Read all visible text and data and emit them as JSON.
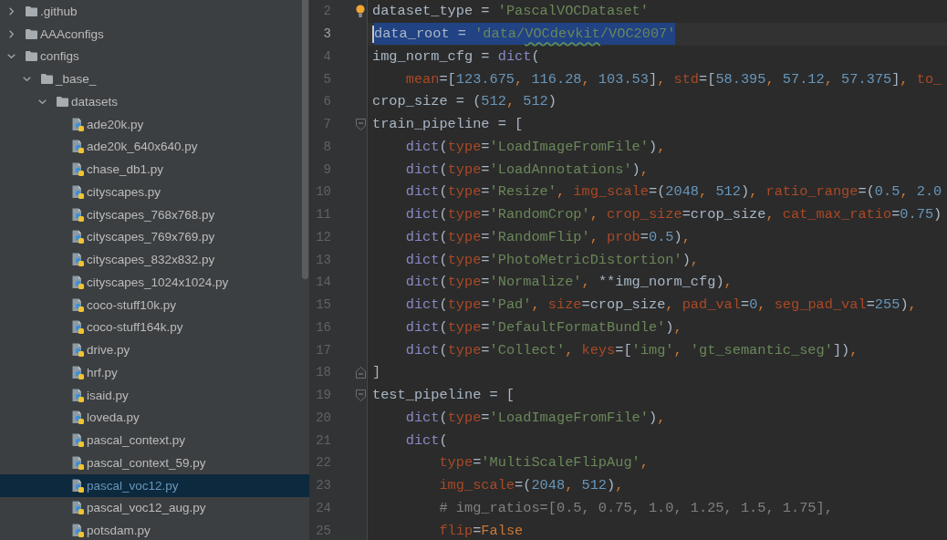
{
  "tree": [
    {
      "label": ".github",
      "kind": "folder",
      "expanded": false,
      "selected": false
    },
    {
      "label": "AAAconfigs",
      "kind": "folder",
      "expanded": false,
      "selected": false
    },
    {
      "label": "configs",
      "kind": "folder",
      "expanded": true,
      "selected": false,
      "children": [
        {
          "label": "_base_",
          "kind": "folder",
          "expanded": true,
          "selected": false,
          "children": [
            {
              "label": "datasets",
              "kind": "folder",
              "expanded": true,
              "selected": false,
              "children": [
                {
                  "label": "ade20k.py",
                  "kind": "file",
                  "selected": false,
                  "modified": false
                },
                {
                  "label": "ade20k_640x640.py",
                  "kind": "file",
                  "selected": false,
                  "modified": false
                },
                {
                  "label": "chase_db1.py",
                  "kind": "file",
                  "selected": false,
                  "modified": false
                },
                {
                  "label": "cityscapes.py",
                  "kind": "file",
                  "selected": false,
                  "modified": false
                },
                {
                  "label": "cityscapes_768x768.py",
                  "kind": "file",
                  "selected": false,
                  "modified": false
                },
                {
                  "label": "cityscapes_769x769.py",
                  "kind": "file",
                  "selected": false,
                  "modified": false
                },
                {
                  "label": "cityscapes_832x832.py",
                  "kind": "file",
                  "selected": false,
                  "modified": false
                },
                {
                  "label": "cityscapes_1024x1024.py",
                  "kind": "file",
                  "selected": false,
                  "modified": false
                },
                {
                  "label": "coco-stuff10k.py",
                  "kind": "file",
                  "selected": false,
                  "modified": false
                },
                {
                  "label": "coco-stuff164k.py",
                  "kind": "file",
                  "selected": false,
                  "modified": false
                },
                {
                  "label": "drive.py",
                  "kind": "file",
                  "selected": false,
                  "modified": false
                },
                {
                  "label": "hrf.py",
                  "kind": "file",
                  "selected": false,
                  "modified": false
                },
                {
                  "label": "isaid.py",
                  "kind": "file",
                  "selected": false,
                  "modified": false
                },
                {
                  "label": "loveda.py",
                  "kind": "file",
                  "selected": false,
                  "modified": false
                },
                {
                  "label": "pascal_context.py",
                  "kind": "file",
                  "selected": false,
                  "modified": false
                },
                {
                  "label": "pascal_context_59.py",
                  "kind": "file",
                  "selected": false,
                  "modified": false
                },
                {
                  "label": "pascal_voc12.py",
                  "kind": "file",
                  "selected": true,
                  "modified": true
                },
                {
                  "label": "pascal_voc12_aug.py",
                  "kind": "file",
                  "selected": false,
                  "modified": false
                },
                {
                  "label": "potsdam.py",
                  "kind": "file",
                  "selected": false,
                  "modified": false
                }
              ]
            }
          ]
        }
      ]
    }
  ],
  "editor": {
    "lines": [
      {
        "number": "2",
        "kind": "bulb",
        "current": false,
        "selected": false,
        "tokens": [
          {
            "kind": "plain",
            "text": "dataset_type = "
          },
          {
            "kind": "string",
            "text": "'PascalVOCDataset'"
          }
        ]
      },
      {
        "number": "3",
        "kind": "plain",
        "current": true,
        "selected": true,
        "tokens": [
          {
            "kind": "plain",
            "text": "data_root = "
          },
          {
            "kind": "string",
            "text": "'data/"
          },
          {
            "kind": "string-typo",
            "text": "VOCdevkit"
          },
          {
            "kind": "string",
            "text": "/VOC2007'"
          }
        ]
      },
      {
        "number": "4",
        "kind": "plain",
        "current": false,
        "selected": false,
        "tokens": [
          {
            "kind": "plain",
            "text": "img_norm_cfg = "
          },
          {
            "kind": "builtin",
            "text": "dict"
          },
          {
            "kind": "plain",
            "text": "("
          }
        ]
      },
      {
        "number": "5",
        "kind": "plain",
        "current": false,
        "selected": false,
        "tokens": [
          {
            "kind": "kwarg",
            "text": "    mean"
          },
          {
            "kind": "plain",
            "text": "=["
          },
          {
            "kind": "number",
            "text": "123.675"
          },
          {
            "kind": "comma",
            "text": ", "
          },
          {
            "kind": "number",
            "text": "116.28"
          },
          {
            "kind": "comma",
            "text": ", "
          },
          {
            "kind": "number",
            "text": "103.53"
          },
          {
            "kind": "plain",
            "text": "]"
          },
          {
            "kind": "comma",
            "text": ", "
          },
          {
            "kind": "kwarg",
            "text": "std"
          },
          {
            "kind": "plain",
            "text": "=["
          },
          {
            "kind": "number",
            "text": "58.395"
          },
          {
            "kind": "comma",
            "text": ", "
          },
          {
            "kind": "number",
            "text": "57.12"
          },
          {
            "kind": "comma",
            "text": ", "
          },
          {
            "kind": "number",
            "text": "57.375"
          },
          {
            "kind": "plain",
            "text": "]"
          },
          {
            "kind": "comma",
            "text": ", "
          },
          {
            "kind": "kwarg",
            "text": "to_"
          }
        ]
      },
      {
        "number": "6",
        "kind": "plain",
        "current": false,
        "selected": false,
        "tokens": [
          {
            "kind": "plain",
            "text": "crop_size = ("
          },
          {
            "kind": "number",
            "text": "512"
          },
          {
            "kind": "comma",
            "text": ", "
          },
          {
            "kind": "number",
            "text": "512"
          },
          {
            "kind": "plain",
            "text": ")"
          }
        ]
      },
      {
        "number": "7",
        "kind": "fold-start",
        "current": false,
        "selected": false,
        "tokens": [
          {
            "kind": "plain",
            "text": "train_pipeline = ["
          }
        ]
      },
      {
        "number": "8",
        "kind": "plain",
        "current": false,
        "selected": false,
        "tokens": [
          {
            "kind": "builtin",
            "text": "    dict"
          },
          {
            "kind": "plain",
            "text": "("
          },
          {
            "kind": "kwarg",
            "text": "type"
          },
          {
            "kind": "plain",
            "text": "="
          },
          {
            "kind": "string",
            "text": "'LoadImageFromFile'"
          },
          {
            "kind": "plain",
            "text": ")"
          },
          {
            "kind": "comma",
            "text": ","
          }
        ]
      },
      {
        "number": "9",
        "kind": "plain",
        "current": false,
        "selected": false,
        "tokens": [
          {
            "kind": "builtin",
            "text": "    dict"
          },
          {
            "kind": "plain",
            "text": "("
          },
          {
            "kind": "kwarg",
            "text": "type"
          },
          {
            "kind": "plain",
            "text": "="
          },
          {
            "kind": "string",
            "text": "'LoadAnnotations'"
          },
          {
            "kind": "plain",
            "text": ")"
          },
          {
            "kind": "comma",
            "text": ","
          }
        ]
      },
      {
        "number": "10",
        "kind": "plain",
        "current": false,
        "selected": false,
        "tokens": [
          {
            "kind": "builtin",
            "text": "    dict"
          },
          {
            "kind": "plain",
            "text": "("
          },
          {
            "kind": "kwarg",
            "text": "type"
          },
          {
            "kind": "plain",
            "text": "="
          },
          {
            "kind": "string",
            "text": "'Resize'"
          },
          {
            "kind": "comma",
            "text": ", "
          },
          {
            "kind": "kwarg",
            "text": "img_scale"
          },
          {
            "kind": "plain",
            "text": "=("
          },
          {
            "kind": "number",
            "text": "2048"
          },
          {
            "kind": "comma",
            "text": ", "
          },
          {
            "kind": "number",
            "text": "512"
          },
          {
            "kind": "plain",
            "text": ")"
          },
          {
            "kind": "comma",
            "text": ", "
          },
          {
            "kind": "kwarg",
            "text": "ratio_range"
          },
          {
            "kind": "plain",
            "text": "=("
          },
          {
            "kind": "number",
            "text": "0.5"
          },
          {
            "kind": "comma",
            "text": ", "
          },
          {
            "kind": "number",
            "text": "2.0"
          }
        ]
      },
      {
        "number": "11",
        "kind": "plain",
        "current": false,
        "selected": false,
        "tokens": [
          {
            "kind": "builtin",
            "text": "    dict"
          },
          {
            "kind": "plain",
            "text": "("
          },
          {
            "kind": "kwarg",
            "text": "type"
          },
          {
            "kind": "plain",
            "text": "="
          },
          {
            "kind": "string",
            "text": "'RandomCrop'"
          },
          {
            "kind": "comma",
            "text": ", "
          },
          {
            "kind": "kwarg",
            "text": "crop_size"
          },
          {
            "kind": "plain",
            "text": "=crop_size"
          },
          {
            "kind": "comma",
            "text": ", "
          },
          {
            "kind": "kwarg",
            "text": "cat_max_ratio"
          },
          {
            "kind": "plain",
            "text": "="
          },
          {
            "kind": "number",
            "text": "0.75"
          },
          {
            "kind": "plain",
            "text": ")"
          }
        ]
      },
      {
        "number": "12",
        "kind": "plain",
        "current": false,
        "selected": false,
        "tokens": [
          {
            "kind": "builtin",
            "text": "    dict"
          },
          {
            "kind": "plain",
            "text": "("
          },
          {
            "kind": "kwarg",
            "text": "type"
          },
          {
            "kind": "plain",
            "text": "="
          },
          {
            "kind": "string",
            "text": "'RandomFlip'"
          },
          {
            "kind": "comma",
            "text": ", "
          },
          {
            "kind": "kwarg",
            "text": "prob"
          },
          {
            "kind": "plain",
            "text": "="
          },
          {
            "kind": "number",
            "text": "0.5"
          },
          {
            "kind": "plain",
            "text": ")"
          },
          {
            "kind": "comma",
            "text": ","
          }
        ]
      },
      {
        "number": "13",
        "kind": "plain",
        "current": false,
        "selected": false,
        "tokens": [
          {
            "kind": "builtin",
            "text": "    dict"
          },
          {
            "kind": "plain",
            "text": "("
          },
          {
            "kind": "kwarg",
            "text": "type"
          },
          {
            "kind": "plain",
            "text": "="
          },
          {
            "kind": "string",
            "text": "'PhotoMetricDistortion'"
          },
          {
            "kind": "plain",
            "text": ")"
          },
          {
            "kind": "comma",
            "text": ","
          }
        ]
      },
      {
        "number": "14",
        "kind": "plain",
        "current": false,
        "selected": false,
        "tokens": [
          {
            "kind": "builtin",
            "text": "    dict"
          },
          {
            "kind": "plain",
            "text": "("
          },
          {
            "kind": "kwarg",
            "text": "type"
          },
          {
            "kind": "plain",
            "text": "="
          },
          {
            "kind": "string",
            "text": "'Normalize'"
          },
          {
            "kind": "comma",
            "text": ", "
          },
          {
            "kind": "plain",
            "text": "**img_norm_cfg)"
          },
          {
            "kind": "comma",
            "text": ","
          }
        ]
      },
      {
        "number": "15",
        "kind": "plain",
        "current": false,
        "selected": false,
        "tokens": [
          {
            "kind": "builtin",
            "text": "    dict"
          },
          {
            "kind": "plain",
            "text": "("
          },
          {
            "kind": "kwarg",
            "text": "type"
          },
          {
            "kind": "plain",
            "text": "="
          },
          {
            "kind": "string",
            "text": "'Pad'"
          },
          {
            "kind": "comma",
            "text": ", "
          },
          {
            "kind": "kwarg",
            "text": "size"
          },
          {
            "kind": "plain",
            "text": "=crop_size"
          },
          {
            "kind": "comma",
            "text": ", "
          },
          {
            "kind": "kwarg",
            "text": "pad_val"
          },
          {
            "kind": "plain",
            "text": "="
          },
          {
            "kind": "number",
            "text": "0"
          },
          {
            "kind": "comma",
            "text": ", "
          },
          {
            "kind": "kwarg",
            "text": "seg_pad_val"
          },
          {
            "kind": "plain",
            "text": "="
          },
          {
            "kind": "number",
            "text": "255"
          },
          {
            "kind": "plain",
            "text": ")"
          },
          {
            "kind": "comma",
            "text": ","
          }
        ]
      },
      {
        "number": "16",
        "kind": "plain",
        "current": false,
        "selected": false,
        "tokens": [
          {
            "kind": "builtin",
            "text": "    dict"
          },
          {
            "kind": "plain",
            "text": "("
          },
          {
            "kind": "kwarg",
            "text": "type"
          },
          {
            "kind": "plain",
            "text": "="
          },
          {
            "kind": "string",
            "text": "'DefaultFormatBundle'"
          },
          {
            "kind": "plain",
            "text": ")"
          },
          {
            "kind": "comma",
            "text": ","
          }
        ]
      },
      {
        "number": "17",
        "kind": "plain",
        "current": false,
        "selected": false,
        "tokens": [
          {
            "kind": "builtin",
            "text": "    dict"
          },
          {
            "kind": "plain",
            "text": "("
          },
          {
            "kind": "kwarg",
            "text": "type"
          },
          {
            "kind": "plain",
            "text": "="
          },
          {
            "kind": "string",
            "text": "'Collect'"
          },
          {
            "kind": "comma",
            "text": ", "
          },
          {
            "kind": "kwarg",
            "text": "keys"
          },
          {
            "kind": "plain",
            "text": "=["
          },
          {
            "kind": "string",
            "text": "'img'"
          },
          {
            "kind": "comma",
            "text": ", "
          },
          {
            "kind": "string",
            "text": "'gt_semantic_seg'"
          },
          {
            "kind": "plain",
            "text": "])"
          },
          {
            "kind": "comma",
            "text": ","
          }
        ]
      },
      {
        "number": "18",
        "kind": "fold-end",
        "current": false,
        "selected": false,
        "tokens": [
          {
            "kind": "plain",
            "text": "]"
          }
        ]
      },
      {
        "number": "19",
        "kind": "fold-start",
        "current": false,
        "selected": false,
        "tokens": [
          {
            "kind": "plain",
            "text": "test_pipeline = ["
          }
        ]
      },
      {
        "number": "20",
        "kind": "plain",
        "current": false,
        "selected": false,
        "tokens": [
          {
            "kind": "builtin",
            "text": "    dict"
          },
          {
            "kind": "plain",
            "text": "("
          },
          {
            "kind": "kwarg",
            "text": "type"
          },
          {
            "kind": "plain",
            "text": "="
          },
          {
            "kind": "string",
            "text": "'LoadImageFromFile'"
          },
          {
            "kind": "plain",
            "text": ")"
          },
          {
            "kind": "comma",
            "text": ","
          }
        ]
      },
      {
        "number": "21",
        "kind": "plain",
        "current": false,
        "selected": false,
        "tokens": [
          {
            "kind": "builtin",
            "text": "    dict"
          },
          {
            "kind": "plain",
            "text": "("
          }
        ]
      },
      {
        "number": "22",
        "kind": "plain",
        "current": false,
        "selected": false,
        "tokens": [
          {
            "kind": "kwarg",
            "text": "        type"
          },
          {
            "kind": "plain",
            "text": "="
          },
          {
            "kind": "string",
            "text": "'MultiScaleFlipAug'"
          },
          {
            "kind": "comma",
            "text": ","
          }
        ]
      },
      {
        "number": "23",
        "kind": "plain",
        "current": false,
        "selected": false,
        "tokens": [
          {
            "kind": "kwarg",
            "text": "        img_scale"
          },
          {
            "kind": "plain",
            "text": "=("
          },
          {
            "kind": "number",
            "text": "2048"
          },
          {
            "kind": "comma",
            "text": ", "
          },
          {
            "kind": "number",
            "text": "512"
          },
          {
            "kind": "plain",
            "text": ")"
          },
          {
            "kind": "comma",
            "text": ","
          }
        ]
      },
      {
        "number": "24",
        "kind": "plain",
        "current": false,
        "selected": false,
        "tokens": [
          {
            "kind": "comment",
            "text": "        # img_ratios=[0.5, 0.75, 1.0, 1.25, 1.5, 1.75],"
          }
        ]
      },
      {
        "number": "25",
        "kind": "plain",
        "current": false,
        "selected": false,
        "tokens": [
          {
            "kind": "kwarg",
            "text": "        flip"
          },
          {
            "kind": "plain",
            "text": "="
          },
          {
            "kind": "keyword",
            "text": "False"
          }
        ]
      }
    ]
  }
}
